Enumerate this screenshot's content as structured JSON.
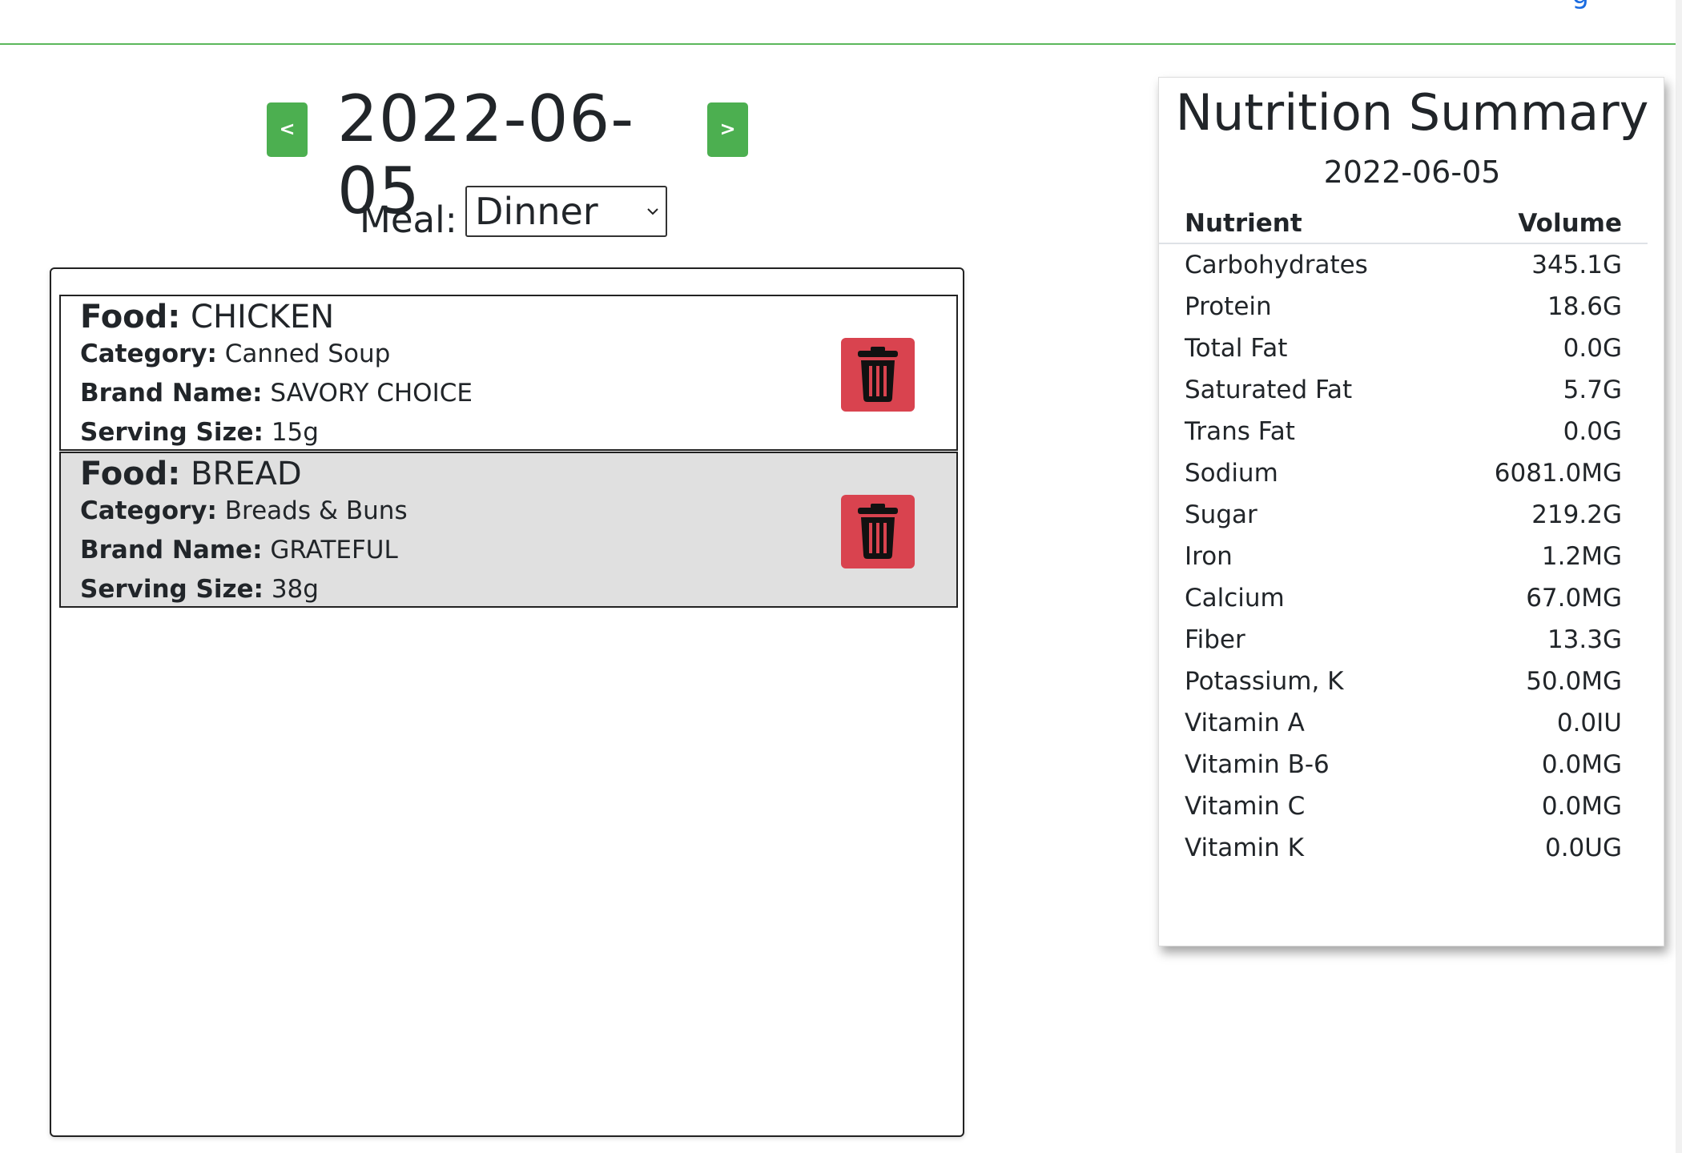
{
  "date_nav": {
    "prev_label": "<",
    "next_label": ">",
    "date": "2022-06-05"
  },
  "meal": {
    "label": "Meal:",
    "selected": "Dinner"
  },
  "field_labels": {
    "food": "Food:",
    "category": "Category:",
    "brand": "Brand Name:",
    "serving": "Serving Size:"
  },
  "foods": [
    {
      "name": "CHICKEN",
      "category": "Canned Soup",
      "brand": "SAVORY CHOICE",
      "serving": "15g"
    },
    {
      "name": "BREAD",
      "category": "Breads & Buns",
      "brand": "GRATEFUL",
      "serving": "38g"
    }
  ],
  "summary": {
    "title": "Nutrition Summary",
    "date": "2022-06-05",
    "headers": {
      "nutrient": "Nutrient",
      "volume": "Volume"
    },
    "rows": [
      {
        "nutrient": "Carbohydrates",
        "volume": "345.1G"
      },
      {
        "nutrient": "Protein",
        "volume": "18.6G"
      },
      {
        "nutrient": "Total Fat",
        "volume": "0.0G"
      },
      {
        "nutrient": "Saturated Fat",
        "volume": "5.7G"
      },
      {
        "nutrient": "Trans Fat",
        "volume": "0.0G"
      },
      {
        "nutrient": "Sodium",
        "volume": "6081.0MG"
      },
      {
        "nutrient": "Sugar",
        "volume": "219.2G"
      },
      {
        "nutrient": "Iron",
        "volume": "1.2MG"
      },
      {
        "nutrient": "Calcium",
        "volume": "67.0MG"
      },
      {
        "nutrient": "Fiber",
        "volume": "13.3G"
      },
      {
        "nutrient": "Potassium, K",
        "volume": "50.0MG"
      },
      {
        "nutrient": "Vitamin A",
        "volume": "0.0IU"
      },
      {
        "nutrient": "Vitamin B-6",
        "volume": "0.0MG"
      },
      {
        "nutrient": "Vitamin C",
        "volume": "0.0MG"
      },
      {
        "nutrient": "Vitamin K",
        "volume": "0.0UG"
      }
    ]
  },
  "colors": {
    "nav_green": "#4caf50",
    "delete_red": "#d9434f",
    "divider_green": "#5cb85c"
  }
}
